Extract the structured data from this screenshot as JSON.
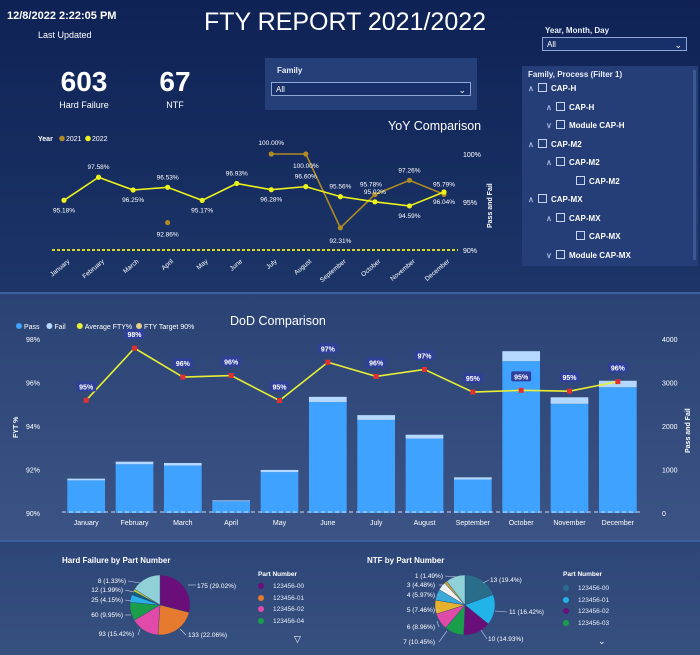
{
  "header": {
    "timestamp": "12/8/2022 2:22:05 PM",
    "last_updated_label": "Last Updated",
    "title": "FTY REPORT 2021/2022"
  },
  "kpis": [
    {
      "value": "603",
      "label": "Hard Failure"
    },
    {
      "value": "67",
      "label": "NTF"
    }
  ],
  "family_slicer": {
    "label": "Family",
    "value": "All"
  },
  "date_slicer": {
    "label": "Year, Month, Day",
    "value": "All"
  },
  "process_tree": {
    "label": "Family, Process (Filter 1)",
    "items": [
      {
        "label": "CAP-H",
        "level": 0
      },
      {
        "label": "CAP-H",
        "level": 1
      },
      {
        "label": "Module CAP-H",
        "level": 1
      },
      {
        "label": "CAP-M2",
        "level": 0
      },
      {
        "label": "CAP-M2",
        "level": 1
      },
      {
        "label": "CAP-M2",
        "level": 2
      },
      {
        "label": "CAP-MX",
        "level": 0
      },
      {
        "label": "CAP-MX",
        "level": 1
      },
      {
        "label": "CAP-MX",
        "level": 2
      },
      {
        "label": "Module CAP-MX",
        "level": 1
      }
    ]
  },
  "colors": {
    "year2021": "#b08a22",
    "year2022": "#eef21d",
    "pass": "#3fa2ff",
    "fail": "#b4d8ff",
    "avg_line": "#e9ef34",
    "avg_marker": "#e03030",
    "label_bg": "#2f3f9a"
  },
  "chart_data": [
    {
      "type": "line",
      "title": "YoY Comparison",
      "legend_title": "Year",
      "categories": [
        "January",
        "February",
        "March",
        "April",
        "May",
        "June",
        "July",
        "August",
        "September",
        "October",
        "November",
        "December"
      ],
      "series": [
        {
          "name": "2021",
          "values": [
            null,
            null,
            null,
            92.86,
            null,
            null,
            100.0,
            100.0,
            92.31,
            95.78,
            97.26,
            95.79
          ]
        },
        {
          "name": "2022",
          "values": [
            95.18,
            97.58,
            96.25,
            96.53,
            95.17,
            96.93,
            96.28,
            96.6,
            95.56,
            95.02,
            94.59,
            96.04
          ]
        }
      ],
      "ylabel": "Pass and Fail",
      "y_ticks": [
        "100%",
        "95%",
        "90%"
      ],
      "ylim": [
        90,
        100
      ],
      "target_line": 90,
      "legend_position": "top-left"
    },
    {
      "type": "bar",
      "title": "DoD Comparison",
      "legend": [
        "Pass",
        "Fail",
        "Average FTY%",
        "FTY Target 90%"
      ],
      "categories": [
        "January",
        "February",
        "March",
        "April",
        "May",
        "June",
        "July",
        "August",
        "September",
        "October",
        "November",
        "December"
      ],
      "series": [
        {
          "name": "Pass",
          "values": [
            750,
            1120,
            1090,
            270,
            940,
            2550,
            2140,
            1710,
            770,
            3490,
            2510,
            2890
          ]
        },
        {
          "name": "Fail",
          "values": [
            40,
            60,
            60,
            20,
            50,
            120,
            110,
            90,
            50,
            230,
            150,
            150
          ]
        },
        {
          "name": "Average FTY%",
          "values": [
            95.18,
            97.58,
            96.25,
            96.32,
            95.17,
            96.93,
            96.28,
            96.6,
            95.56,
            95.64,
            95.6,
            96.04
          ]
        }
      ],
      "bar_labels": [
        "95%",
        "98%",
        "96%",
        "96%",
        "95%",
        "97%",
        "96%",
        "97%",
        "95%",
        "95%",
        "95%",
        "96%"
      ],
      "ylabel_left": "FYT %",
      "ylabel_right": "Pass and Fail",
      "y_left_ticks": [
        "98%",
        "96%",
        "94%",
        "92%",
        "90%"
      ],
      "y_right_ticks": [
        "4000",
        "3000",
        "2000",
        "1000",
        "0"
      ],
      "ylim_left": [
        90,
        98
      ],
      "ylim_right": [
        0,
        4000
      ],
      "target": 90,
      "legend_position": "top-left"
    },
    {
      "type": "pie",
      "title": "Hard Failure by Part Number",
      "legend_title": "Part Number",
      "legend": [
        "123456-00",
        "123456-01",
        "123456-02",
        "123456-04"
      ],
      "slices": [
        {
          "value": 175,
          "label": "175 (29.02%)",
          "color": "#6a0f7a"
        },
        {
          "value": 133,
          "label": "133 (22.06%)",
          "color": "#e67a2e"
        },
        {
          "value": 93,
          "label": "93 (15.42%)",
          "color": "#e04aa8"
        },
        {
          "value": 60,
          "label": "60 (9.95%)",
          "color": "#1a9e4a"
        },
        {
          "value": 25,
          "label": "25 (4.15%)",
          "color": "#2aaee8"
        },
        {
          "value": 12,
          "label": "12 (1.99%)",
          "color": "#0e5f7a"
        },
        {
          "value": 8,
          "label": "8 (1.33%)",
          "color": "#c7c737"
        },
        {
          "value": 97,
          "label": "",
          "color": "#8fd1d6"
        }
      ],
      "legend_colors": [
        "#6a0f7a",
        "#e67a2e",
        "#e04aa8",
        "#1a9e4a"
      ]
    },
    {
      "type": "pie",
      "title": "NTF by Part Number",
      "legend_title": "Part Number",
      "legend": [
        "123456-00",
        "123456-01",
        "123456-02",
        "123456-03"
      ],
      "slices": [
        {
          "value": 13,
          "label": "13 (19.4%)",
          "color": "#2a6d8a"
        },
        {
          "value": 11,
          "label": "11 (16.42%)",
          "color": "#22b4e8"
        },
        {
          "value": 10,
          "label": "10 (14.93%)",
          "color": "#6a0f7a"
        },
        {
          "value": 7,
          "label": "7 (10.45%)",
          "color": "#1a9e4a"
        },
        {
          "value": 6,
          "label": "6 (8.96%)",
          "color": "#e04aa8"
        },
        {
          "value": 5,
          "label": "5 (7.46%)",
          "color": "#e6b22e"
        },
        {
          "value": 4,
          "label": "4 (5.97%)",
          "color": "#3aa9d8"
        },
        {
          "value": 3,
          "label": "3 (4.48%)",
          "color": "#f2f2f2"
        },
        {
          "value": 1,
          "label": "1 (1.49%)",
          "color": "#c7a637"
        },
        {
          "value": 7,
          "label": "",
          "color": "#8fd1d6"
        }
      ],
      "legend_colors": [
        "#2a6d8a",
        "#22b4e8",
        "#6a0f7a",
        "#1a9e4a"
      ]
    }
  ]
}
